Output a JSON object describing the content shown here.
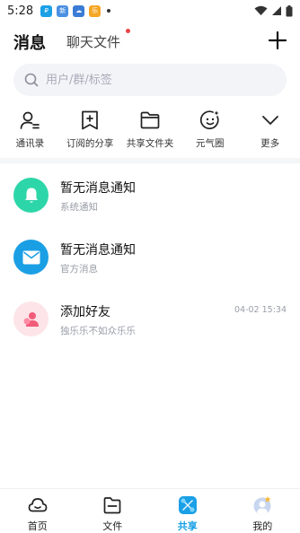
{
  "status_bar": {
    "time": "5:28",
    "apps": [
      {
        "icon": "payment-app-icon",
        "text": "₽",
        "color": "#1aa0e6"
      },
      {
        "icon": "news-app-icon",
        "text": "新闻",
        "color": "#4a90e2"
      },
      {
        "icon": "cloud-app-icon",
        "text": "☁",
        "color": "#3a7bd5"
      },
      {
        "icon": "game-app-icon",
        "text": "乐",
        "color": "#f5a623"
      }
    ]
  },
  "header": {
    "tab_messages": "消息",
    "tab_chat_files": "聊天文件"
  },
  "search": {
    "placeholder": "用户/群/标签"
  },
  "quick_actions": [
    {
      "label": "通讯录",
      "icon": "contacts-icon"
    },
    {
      "label": "订阅的分享",
      "icon": "subscribed-share-icon"
    },
    {
      "label": "共享文件夹",
      "icon": "shared-folder-icon"
    },
    {
      "label": "元气圈",
      "icon": "circle-icon"
    },
    {
      "label": "更多",
      "icon": "chevron-down-icon"
    }
  ],
  "messages": [
    {
      "title": "暂无消息通知",
      "subtitle": "系统通知",
      "time": "",
      "icon": "bell-icon",
      "color": "#2dd6a8"
    },
    {
      "title": "暂无消息通知",
      "subtitle": "官方消息",
      "time": "",
      "icon": "mail-icon",
      "color": "#1a9fe4"
    },
    {
      "title": "添加好友",
      "subtitle": "独乐乐不如众乐乐",
      "time": "04-02 15:34",
      "icon": "add-friend-icon",
      "color": "#fde4e8"
    }
  ],
  "bottom_nav": [
    {
      "label": "首页",
      "icon": "home-icon",
      "active": false
    },
    {
      "label": "文件",
      "icon": "file-icon",
      "active": false
    },
    {
      "label": "共享",
      "icon": "share-icon",
      "active": true
    },
    {
      "label": "我的",
      "icon": "profile-icon",
      "active": false
    }
  ]
}
